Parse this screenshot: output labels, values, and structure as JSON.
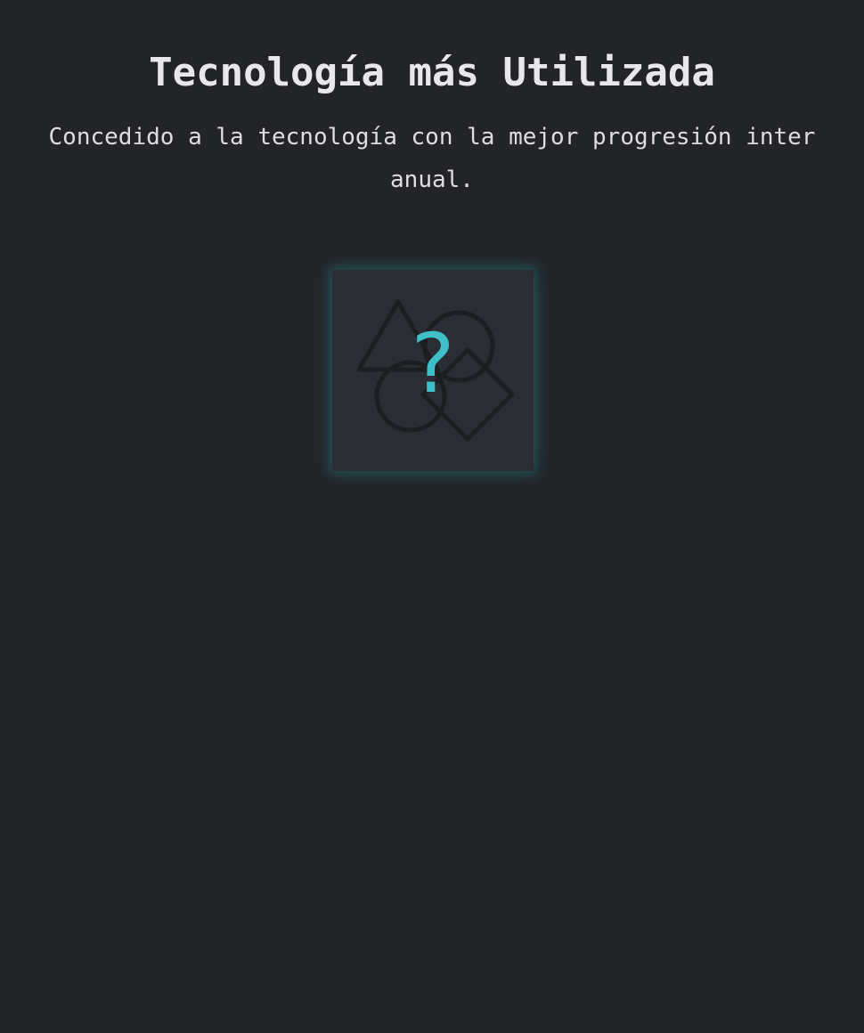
{
  "award": {
    "title": "Tecnología más Utilizada",
    "description": "Concedido a la tecnología con la mejor progresión inter anual.",
    "placeholder_symbol": "?",
    "placeholder_icon": "shapes-icon"
  },
  "colors": {
    "background": "#232428",
    "card": "#2a2d34",
    "accent": "#3fc0c8",
    "shape_outline": "#1d1e21"
  }
}
